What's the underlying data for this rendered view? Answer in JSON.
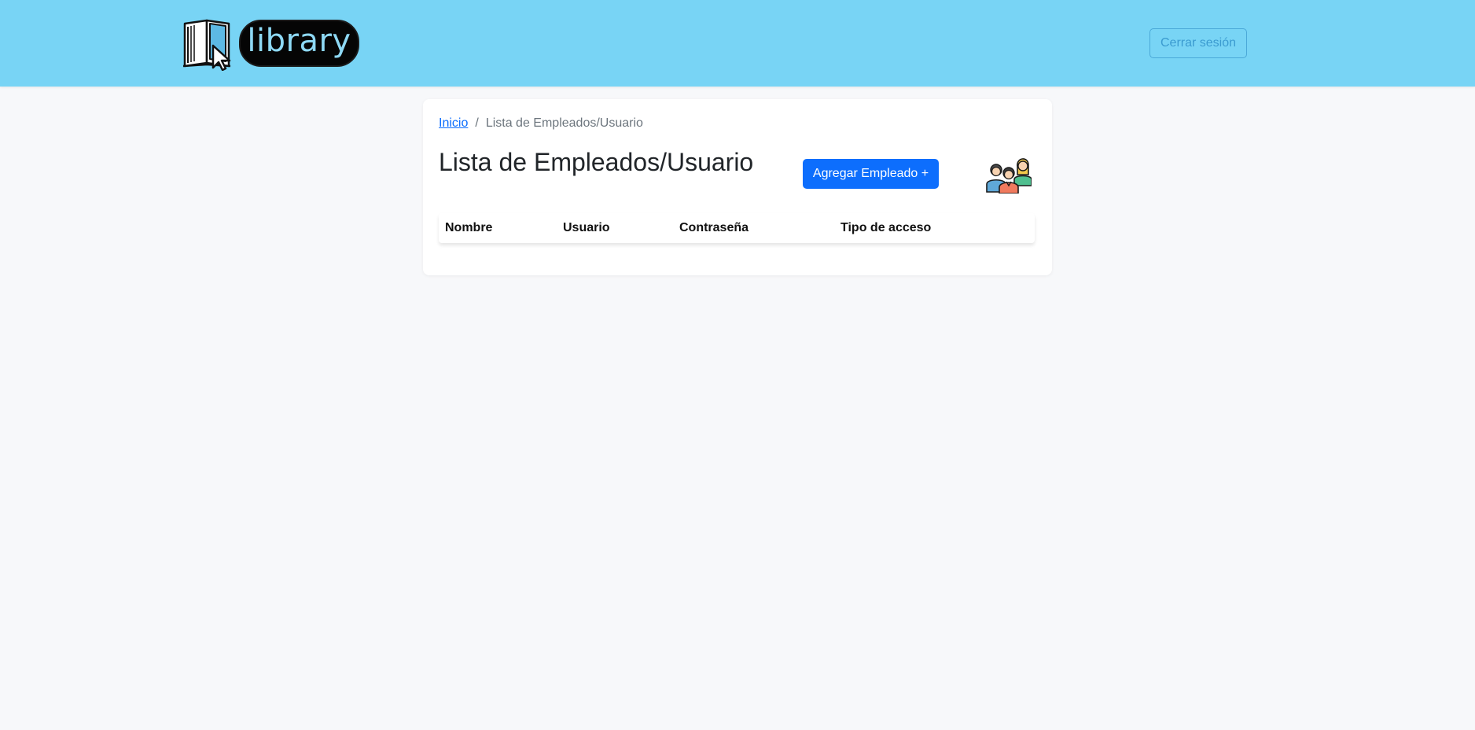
{
  "header": {
    "logo_text": "library",
    "logo_icon": "book-cursor-icon",
    "logout_label": "Cerrar sesión",
    "background_color": "#78d4f5"
  },
  "breadcrumb": {
    "home_label": "Inicio",
    "separator": "/",
    "current_label": "Lista de Empleados/Usuario"
  },
  "main": {
    "title": "Lista de Empleados/Usuario",
    "add_button_label": "Agregar Empleado +",
    "add_button_color": "#0d6efd",
    "illustration_icon": "people-group-icon"
  },
  "table": {
    "columns": [
      "Nombre",
      "Usuario",
      "Contraseña",
      "Tipo de acceso"
    ],
    "rows": []
  }
}
